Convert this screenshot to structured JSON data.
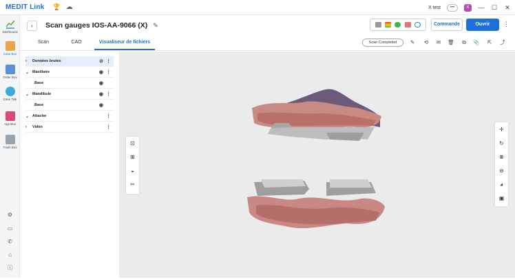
{
  "app": {
    "brand": "MEDIT Link",
    "user": "X test",
    "user_menu": "•••",
    "avatar_letter": "X",
    "window_controls": [
      "—",
      "☐",
      "✕"
    ]
  },
  "sidebar": {
    "items": [
      {
        "label": "Dashboard",
        "icon": "dashboard-icon",
        "color": "#6aa84f"
      },
      {
        "label": "Case Box",
        "icon": "case-box-icon",
        "color": "#e8a64a",
        "active": true
      },
      {
        "label": "Order Box",
        "icon": "order-box-icon",
        "color": "#5b8fd9"
      },
      {
        "label": "Case Talk",
        "icon": "case-talk-icon",
        "color": "#3fa9d8"
      },
      {
        "label": "App Box",
        "icon": "app-box-icon",
        "color": "#d94a7a"
      },
      {
        "label": "Trash Box",
        "icon": "trash-box-icon",
        "color": "#9aa4ae"
      }
    ],
    "bottom_icons": [
      "settings-icon",
      "camera-icon",
      "announcement-icon",
      "home-icon",
      "info-icon"
    ]
  },
  "header": {
    "back": "‹",
    "title": "Scan gauges IOS-AA-9066 (X)",
    "commande": "Commande",
    "ouvrir": "Ouvrir",
    "more": "⋮"
  },
  "tabs": [
    {
      "label": "Scan"
    },
    {
      "label": "CAO"
    },
    {
      "label": "Visualiseur de fichiers",
      "active": true
    }
  ],
  "status": "Scan Completed",
  "tree": [
    {
      "label": "Données brutes",
      "chevron": "›",
      "selected": true,
      "eye": "hidden"
    },
    {
      "label": "Maxillaire",
      "chevron": "⌄",
      "eye": "visible"
    },
    {
      "label": "Base",
      "sub": true,
      "eye": "visible"
    },
    {
      "label": "Mandibule",
      "chevron": "⌄",
      "eye": "visible"
    },
    {
      "label": "Base",
      "sub": true,
      "eye": "visible"
    },
    {
      "label": "Attache",
      "chevron": "⌄"
    },
    {
      "label": "Vidéo",
      "chevron": "›"
    }
  ],
  "menu_dots": "⋮",
  "colors": {
    "accent": "#1e6fd9",
    "viewport_bg": "#ebebeb",
    "selected_row": "#e4eefb"
  }
}
